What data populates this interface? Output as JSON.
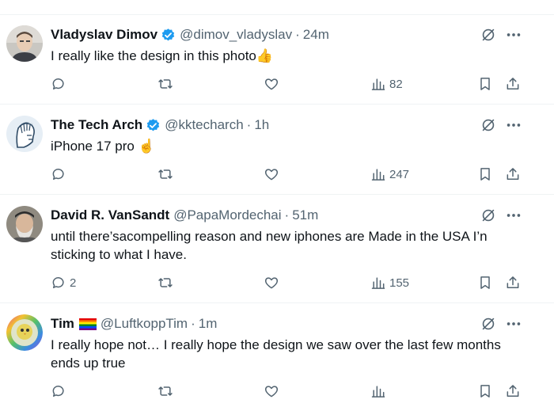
{
  "tweets": [
    {
      "name": "Vladyslav Dimov",
      "verified": true,
      "handle": "@dimov_vladyslav",
      "sep": "·",
      "time": "24m",
      "text": "I really like the design in this photo👍",
      "replies": "",
      "retweets": "",
      "likes": "",
      "views": "82",
      "avatar_icon": "man-portrait-avatar"
    },
    {
      "name": "The Tech Arch",
      "verified": true,
      "handle": "@kktecharch",
      "sep": "·",
      "time": "1h",
      "text": "iPhone 17 pro ☝️",
      "replies": "",
      "retweets": "",
      "likes": "",
      "views": "247",
      "avatar_icon": "sketch-head-avatar"
    },
    {
      "name": "David R. VanSandt",
      "verified": false,
      "handle": "@PapaMordechai",
      "sep": "·",
      "time": "51m",
      "text": "until there’sacompelling reason and new iphones are Made in the USA I’n sticking to what I have.",
      "replies": "2",
      "retweets": "",
      "likes": "",
      "views": "155",
      "avatar_icon": "bearded-man-avatar"
    },
    {
      "name": "Tim",
      "verified": false,
      "flag": "rainbow-flag-icon",
      "handle": "@LuftkoppTim",
      "sep": "·",
      "time": "1m",
      "text": "I really hope not… I really hope the design we saw over the last few months ends up true",
      "replies": "",
      "retweets": "",
      "likes": "",
      "views": "",
      "avatar_icon": "rainbow-ring-avatar"
    }
  ],
  "colors": {
    "text": "#0f1419",
    "secondary": "#536471",
    "verified": "#1d9bf0",
    "divider": "#eff3f4"
  }
}
